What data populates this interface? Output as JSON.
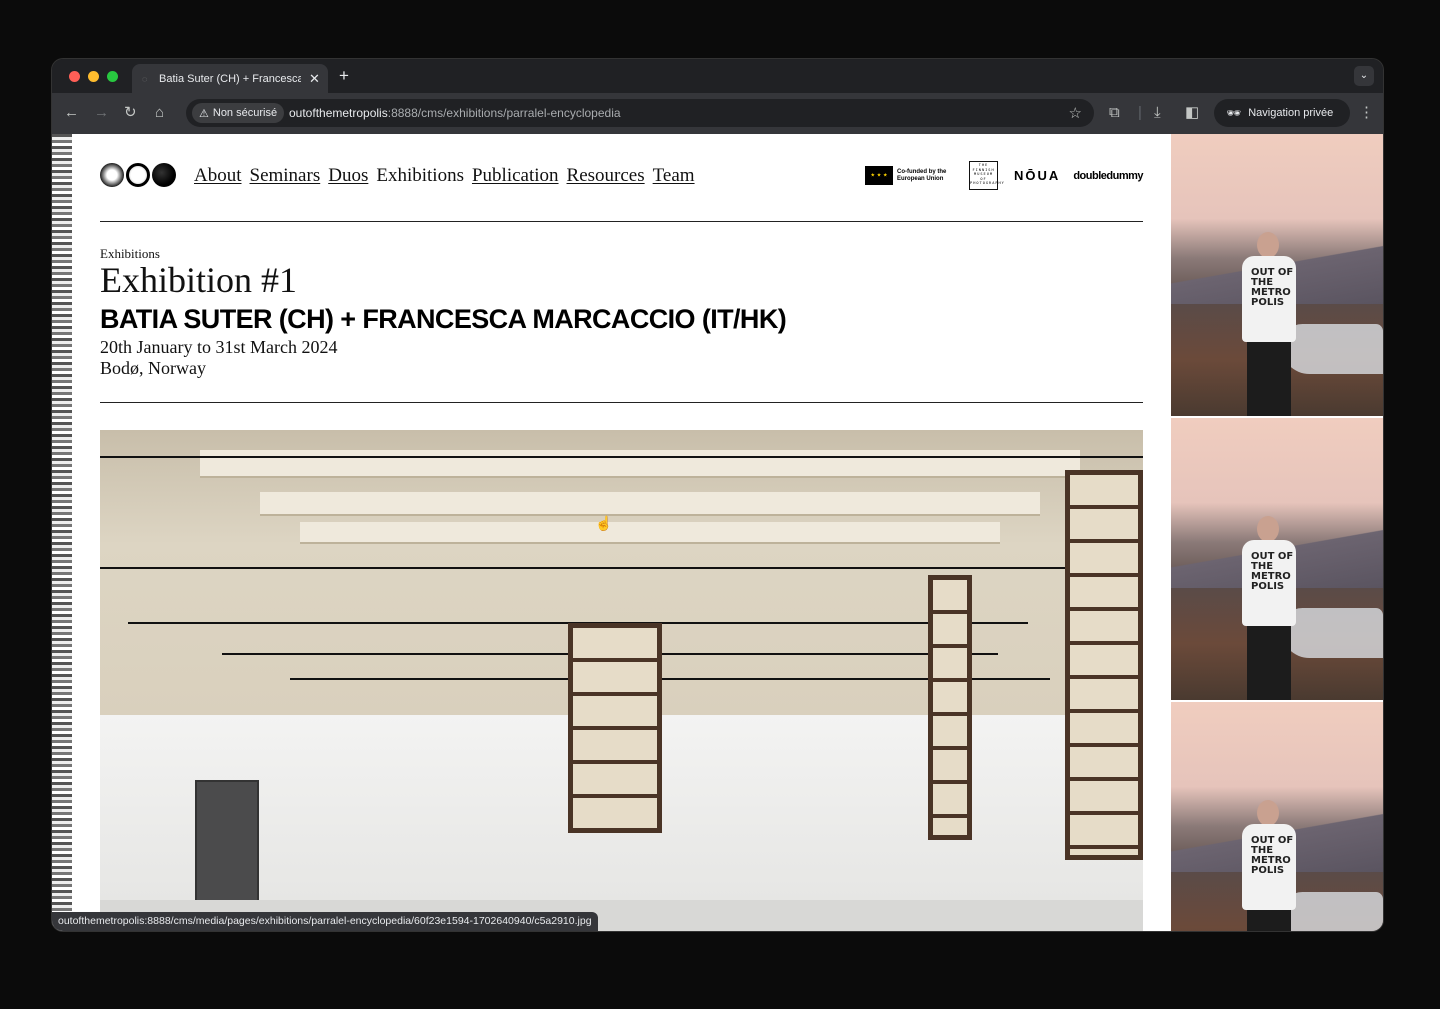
{
  "browser": {
    "tab_title": "Batia Suter (CH) + Francesca",
    "tab_close": "✕",
    "new_tab": "+",
    "security_label": "Non sécurisé",
    "url_host": "outofthemetropolis",
    "url_path": ":8888/cms/exhibitions/parralel-encyclopedia",
    "private_label": "Navigation privée",
    "status_url": "outofthemetropolis:8888/cms/media/pages/exhibitions/parralel-encyclopedia/60f23e1594-1702640940/c5a2910.jpg"
  },
  "nav": {
    "items": [
      "About",
      "Seminars",
      "Duos",
      "Exhibitions",
      "Publication",
      "Resources",
      "Team"
    ]
  },
  "partners": {
    "eu": "Co-funded by the European Union",
    "finnish": "THE FINNISH MUSEUM OF PHOTOGRAPHY",
    "noua": "NŌUA",
    "doubledummy": "doubledummy"
  },
  "exhibition": {
    "breadcrumb": "Exhibitions",
    "title": "Exhibition #1",
    "artists": "BATIA SUTER (CH) + FRANCESCA MARCACCIO (IT/HK)",
    "dates": "20th January to 31st March 2024",
    "location": "Bodø, Norway"
  },
  "side": {
    "shirt_text": "OUT OF THE METRO POLIS"
  },
  "colors": {
    "chrome_dark": "#202124",
    "chrome_toolbar": "#35363a",
    "close_red": "#ff5f57",
    "min_yellow": "#febc2e",
    "max_green": "#28c840"
  }
}
